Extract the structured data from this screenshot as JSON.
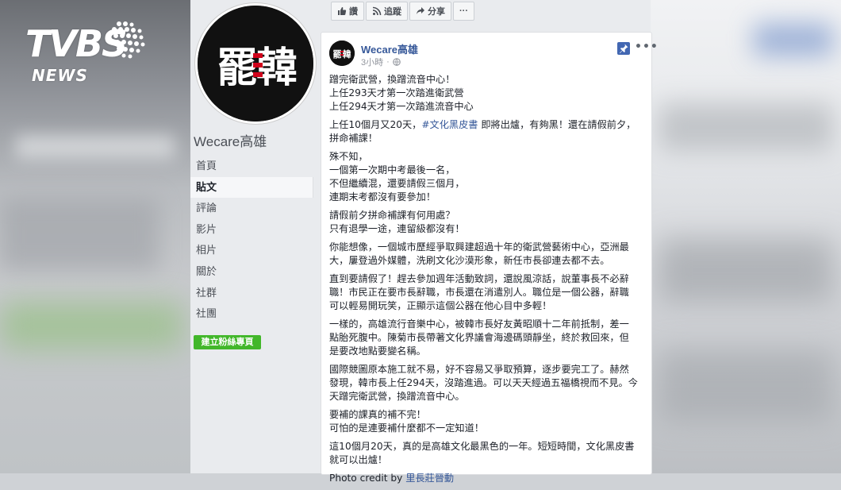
{
  "watermark": {
    "brand": "TVBS",
    "sub": "NEWS"
  },
  "page": {
    "name": "Wecare高雄",
    "logo_text": "罷韓",
    "nav": [
      "首頁",
      "貼文",
      "評論",
      "影片",
      "相片",
      "關於",
      "社群",
      "社團"
    ],
    "active_nav": "貼文",
    "create_button": "建立粉絲專頁"
  },
  "actions": {
    "like": "讚",
    "follow": "追蹤",
    "share": "分享",
    "more": "···"
  },
  "post": {
    "author": "Wecare高雄",
    "time": "3小時",
    "paragraphs": [
      [
        "蹭完衛武營，換蹭流音中心！",
        "上任293天才第一次踏進衛武營",
        "上任294天才第一次踏進流音中心"
      ],
      [
        "上任10個月又20天，",
        "#文化黑皮書",
        " 即將出爐，有夠黑！還在請假前夕，",
        "拼命補課！"
      ],
      [
        "殊不知，",
        "一個第一次期中考最後一名，",
        "不但繼續混，還要請假三個月，",
        "連期末考都沒有要參加！"
      ],
      [
        "請假前夕拼命補課有何用處？",
        "只有退學一途，連留級都沒有！"
      ],
      [
        "你能想像，一個城市歷經爭取興建超過十年的衛武營藝術中心，亞洲最",
        "大，屢登過外媒體，洗刷文化沙漠形象，新任市長卻連去都不去。"
      ],
      [
        "直到要請假了！趕去參加週年活動致詞，還說風涼話，說董事長不必辭",
        "職！市民正在要市長辭職，市長還在消遣別人。職位是一個公器，辭職",
        "可以輕易開玩笑，正顯示這個公器在他心目中多輕！"
      ],
      [
        "一樣的，高雄流行音樂中心，被韓市長好友黃昭順十二年前抵制，差一",
        "點胎死腹中。陳菊市長帶著文化界議會海邊碼頭靜坐，終於救回來，但",
        "是要改地點要變名稱。"
      ],
      [
        "國際競圖原本施工就不易，好不容易又爭取預算，逐步要完工了。赫然",
        "發現，韓市長上任294天，沒踏進過。可以天天經過五福橋視而不見。今",
        "天蹭完衛武營，換蹭流音中心。"
      ],
      [
        "要補的課真的補不完！",
        "可怕的是連要補什麼都不一定知道！"
      ],
      [
        "這10個月20天，真的是高雄文化最黑色的一年。短短時間，文化黑皮書",
        "就可以出爐！"
      ]
    ],
    "credit_prefix": "Photo credit by ",
    "credit_name": "里長莊晉動"
  },
  "colors": {
    "accent": "#365899",
    "green": "#42b72a",
    "pin": "#4267b2"
  },
  "icons": [
    "thumbs-up-icon",
    "rss-icon",
    "share-icon",
    "globe-icon",
    "pin-icon",
    "more-icon"
  ]
}
